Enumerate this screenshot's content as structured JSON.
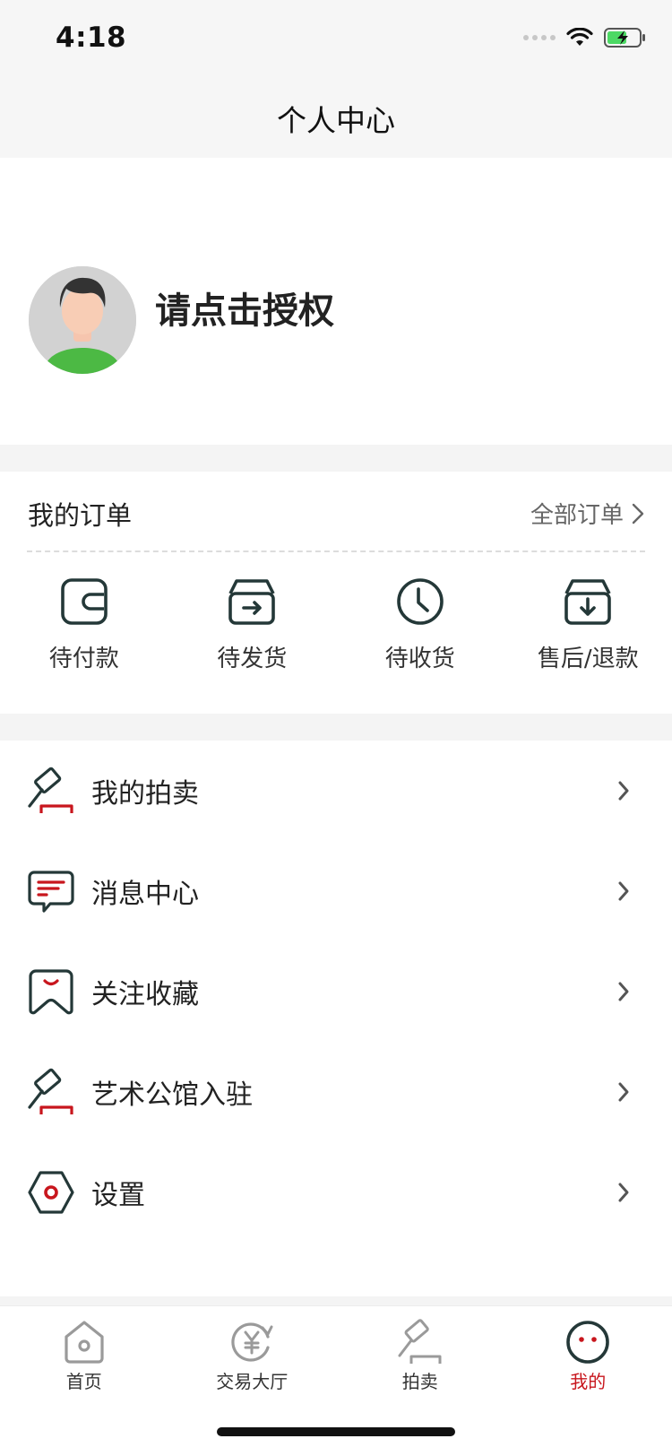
{
  "status_bar": {
    "time": "4:18"
  },
  "nav": {
    "title": "个人中心"
  },
  "profile": {
    "name": "请点击授权"
  },
  "orders": {
    "title": "我的订单",
    "all_label": "全部订单",
    "items": [
      {
        "label": "待付款",
        "icon": "wallet-icon"
      },
      {
        "label": "待发货",
        "icon": "ship-box-icon"
      },
      {
        "label": "待收货",
        "icon": "clock-icon"
      },
      {
        "label": "售后/退款",
        "icon": "return-box-icon"
      }
    ]
  },
  "menu": {
    "items": [
      {
        "label": "我的拍卖",
        "icon": "gavel-icon"
      },
      {
        "label": "消息中心",
        "icon": "message-icon"
      },
      {
        "label": "关注收藏",
        "icon": "favorite-icon"
      },
      {
        "label": "艺术公馆入驻",
        "icon": "gavel-icon"
      },
      {
        "label": "设置",
        "icon": "settings-icon"
      }
    ]
  },
  "tabbar": {
    "items": [
      {
        "label": "首页",
        "icon": "home-icon",
        "active": false
      },
      {
        "label": "交易大厅",
        "icon": "yuan-exchange-icon",
        "active": false
      },
      {
        "label": "拍卖",
        "icon": "gavel-icon",
        "active": false
      },
      {
        "label": "我的",
        "icon": "face-icon",
        "active": true
      }
    ]
  },
  "colors": {
    "accent": "#c8161d",
    "icon_stroke": "#243838",
    "tab_inactive": "#9a9a9a",
    "background": "#f4f4f4"
  }
}
